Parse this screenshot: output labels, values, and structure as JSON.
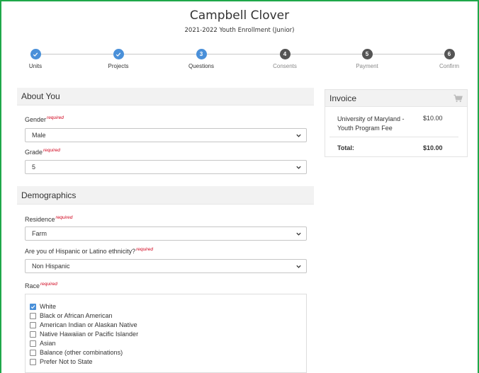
{
  "header": {
    "title": "Campbell Clover",
    "subtitle": "2021-2022 Youth Enrollment (Junior)"
  },
  "stepper": {
    "steps": [
      {
        "label": "Units",
        "number": "",
        "state": "done"
      },
      {
        "label": "Projects",
        "number": "",
        "state": "done"
      },
      {
        "label": "Questions",
        "number": "3",
        "state": "active"
      },
      {
        "label": "Consents",
        "number": "4",
        "state": "pending"
      },
      {
        "label": "Payment",
        "number": "5",
        "state": "pending"
      },
      {
        "label": "Confirm",
        "number": "6",
        "state": "pending"
      }
    ]
  },
  "about_you": {
    "heading": "About You",
    "gender": {
      "label": "Gender",
      "required": "required",
      "value": "Male"
    },
    "grade": {
      "label": "Grade",
      "required": "required",
      "value": "5"
    }
  },
  "demographics": {
    "heading": "Demographics",
    "residence": {
      "label": "Residence",
      "required": "required",
      "value": "Farm"
    },
    "ethnicity": {
      "label": "Are you of Hispanic or Latino ethnicity?",
      "required": "required",
      "value": "Non Hispanic"
    },
    "race": {
      "label": "Race",
      "required": "required",
      "options": [
        {
          "label": "White",
          "checked": true
        },
        {
          "label": "Black or African American",
          "checked": false
        },
        {
          "label": "American Indian or Alaskan Native",
          "checked": false
        },
        {
          "label": "Native Hawaiian or Pacific Islander",
          "checked": false
        },
        {
          "label": "Asian",
          "checked": false
        },
        {
          "label": "Balance (other combinations)",
          "checked": false
        },
        {
          "label": "Prefer Not to State",
          "checked": false
        }
      ]
    }
  },
  "invoice": {
    "heading": "Invoice",
    "item_name": "University of Maryland - Youth Program Fee",
    "item_price": "$10.00",
    "total_label": "Total:",
    "total_value": "$10.00"
  },
  "colors": {
    "accent": "#4a90d9",
    "frame": "#1fa84a",
    "required": "#d0021b"
  }
}
